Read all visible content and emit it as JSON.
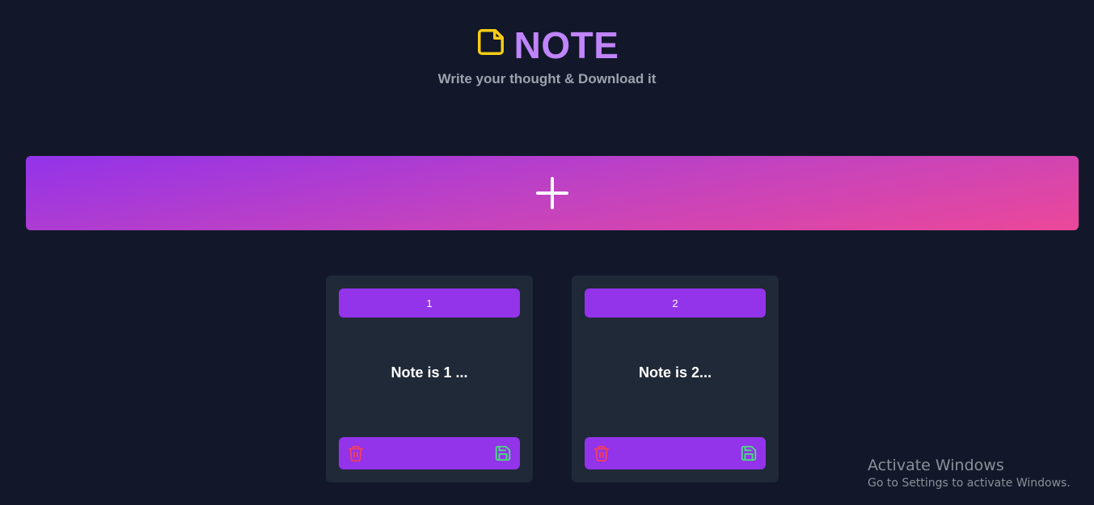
{
  "header": {
    "title": "NOTE",
    "subtitle": "Write your thought & Download it",
    "icon": "sticky-note-icon"
  },
  "add_button": {
    "icon": "plus-icon"
  },
  "notes": [
    {
      "id_label": "1",
      "text": "Note is 1 ..."
    },
    {
      "id_label": "2",
      "text": "Note is 2..."
    }
  ],
  "note_actions": {
    "delete_icon": "trash-icon",
    "save_icon": "floppy-disk-icon"
  },
  "watermark": {
    "title": "Activate Windows",
    "subtitle": "Go to Settings to activate Windows."
  },
  "colors": {
    "background": "#121829",
    "card": "#1f2937",
    "accent": "#9333ea",
    "title": "#c084fc",
    "icon_yellow": "#facc15",
    "delete": "#f43f5e",
    "save": "#4ade80",
    "gradient_end": "#ec4899"
  }
}
